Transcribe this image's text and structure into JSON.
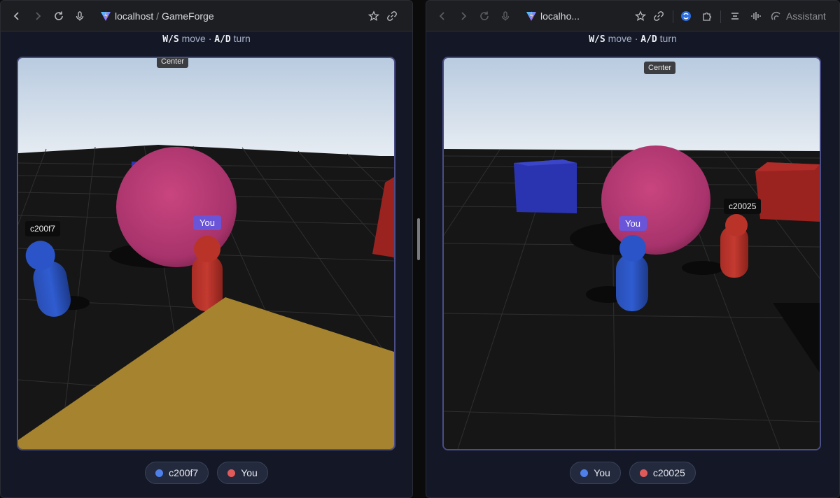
{
  "colors": {
    "blue_player": "#4f7fe8",
    "red_player": "#e05a5a",
    "you_badge": "#6a55d8",
    "floor": "#161616",
    "sky_top": "#b9cbe0",
    "sky_bottom": "#e6ecf2",
    "ball": "#b93e7a",
    "gold_plane": "#a6832e"
  },
  "left": {
    "address": {
      "host": "localhost",
      "separator": "/",
      "title": "GameForge"
    },
    "controls_hint": {
      "key1": "W/S",
      "action1": "move",
      "dot": "·",
      "key2": "A/D",
      "action2": "turn"
    },
    "scene": {
      "center_label": "Center",
      "other_player_label": "c200f7",
      "you_label": "You"
    },
    "players": [
      {
        "name": "c200f7",
        "color": "#4f7fe8"
      },
      {
        "name": "You",
        "color": "#e05a5a"
      }
    ],
    "icons": [
      "back-icon",
      "forward-icon",
      "reload-icon",
      "mic-icon",
      "star-icon",
      "link-icon"
    ]
  },
  "right": {
    "address": {
      "host": "localho..."
    },
    "assistant_label": "Assistant",
    "controls_hint": {
      "key1": "W/S",
      "action1": "move",
      "dot": "·",
      "key2": "A/D",
      "action2": "turn"
    },
    "scene": {
      "center_label": "Center",
      "other_player_label": "c20025",
      "you_label": "You"
    },
    "players": [
      {
        "name": "You",
        "color": "#4f7fe8"
      },
      {
        "name": "c20025",
        "color": "#e05a5a"
      }
    ],
    "icons": [
      "back-icon",
      "forward-icon",
      "reload-icon",
      "mic-icon",
      "star-icon",
      "link-icon",
      "extension-sync-icon",
      "puzzle-icon",
      "lines-icon",
      "waveform-icon",
      "assistant-icon"
    ]
  }
}
